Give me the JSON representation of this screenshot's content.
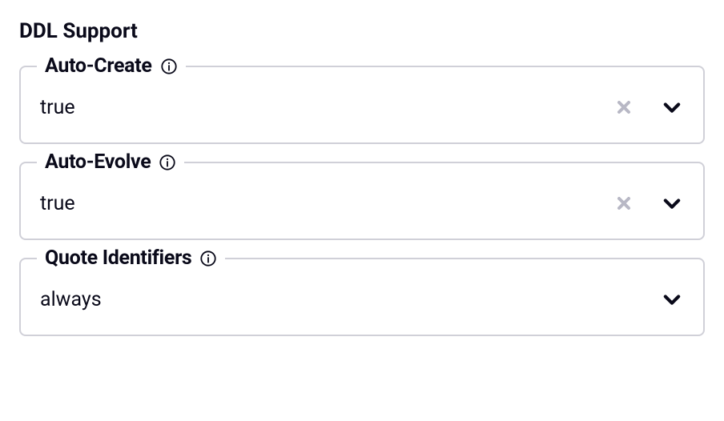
{
  "section": {
    "title": "DDL Support"
  },
  "fields": {
    "auto_create": {
      "label": "Auto-Create",
      "value": "true",
      "clearable": true
    },
    "auto_evolve": {
      "label": "Auto-Evolve",
      "value": "true",
      "clearable": true
    },
    "quote_identifiers": {
      "label": "Quote Identifiers",
      "value": "always",
      "clearable": false
    }
  }
}
